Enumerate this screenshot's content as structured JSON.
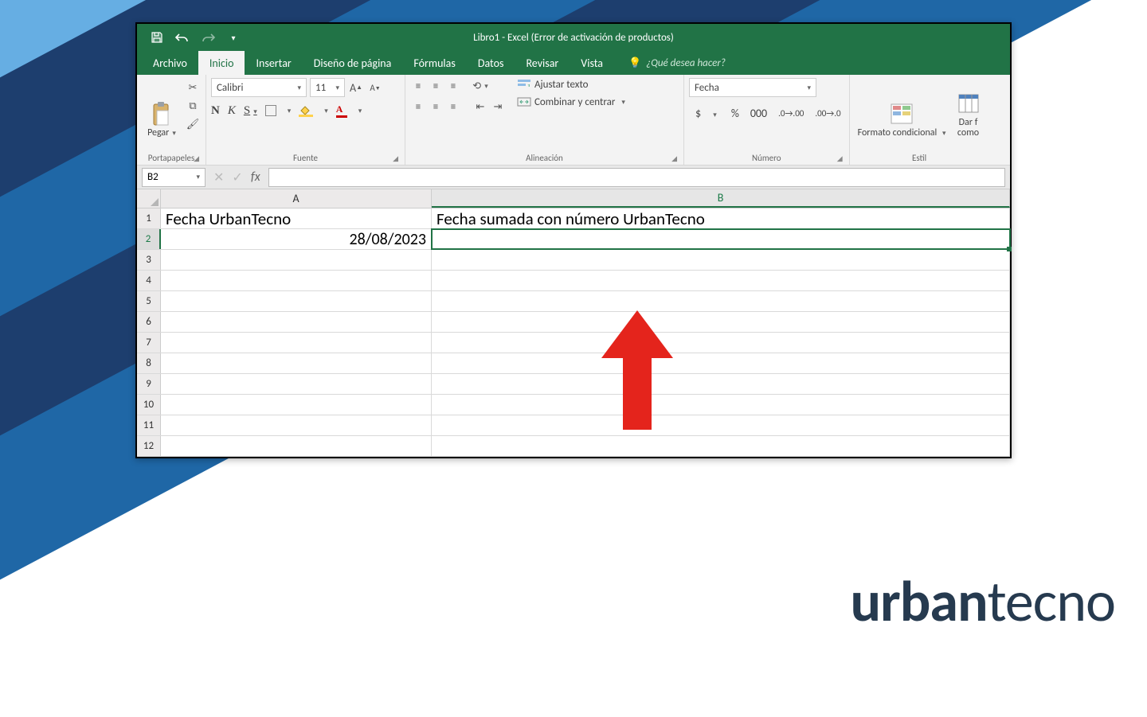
{
  "window": {
    "title": "Libro1 - Excel (Error de activación de productos)"
  },
  "tabs": {
    "archivo": "Archivo",
    "inicio": "Inicio",
    "insertar": "Insertar",
    "diseno": "Diseño de página",
    "formulas": "Fórmulas",
    "datos": "Datos",
    "revisar": "Revisar",
    "vista": "Vista",
    "tellme": "¿Qué desea hacer?"
  },
  "ribbon": {
    "clipboard": {
      "paste": "Pegar",
      "label": "Portapapeles"
    },
    "font": {
      "name": "Calibri",
      "size": "11",
      "bold": "N",
      "italic": "K",
      "underline": "S",
      "label": "Fuente"
    },
    "alignment": {
      "wrap": "Ajustar texto",
      "merge": "Combinar y centrar",
      "label": "Alineación"
    },
    "number": {
      "format": "Fecha",
      "currency": "$",
      "percent": "%",
      "thousands": "000",
      "label": "Número"
    },
    "styles": {
      "cond": "Formato condicional",
      "darf": "Dar f",
      "como": "como",
      "label": "Estil"
    }
  },
  "namebox": "B2",
  "fx_label": "fx",
  "grid": {
    "colA": "A",
    "colB": "B",
    "rows": [
      "1",
      "2",
      "3",
      "4",
      "5",
      "6",
      "7",
      "8",
      "9",
      "10",
      "11",
      "12"
    ],
    "a1": "Fecha UrbanTecno",
    "b1": "Fecha sumada con número UrbanTecno",
    "a2": "28/08/2023"
  },
  "watermark": {
    "part1": "urban",
    "part2": "tecno"
  }
}
